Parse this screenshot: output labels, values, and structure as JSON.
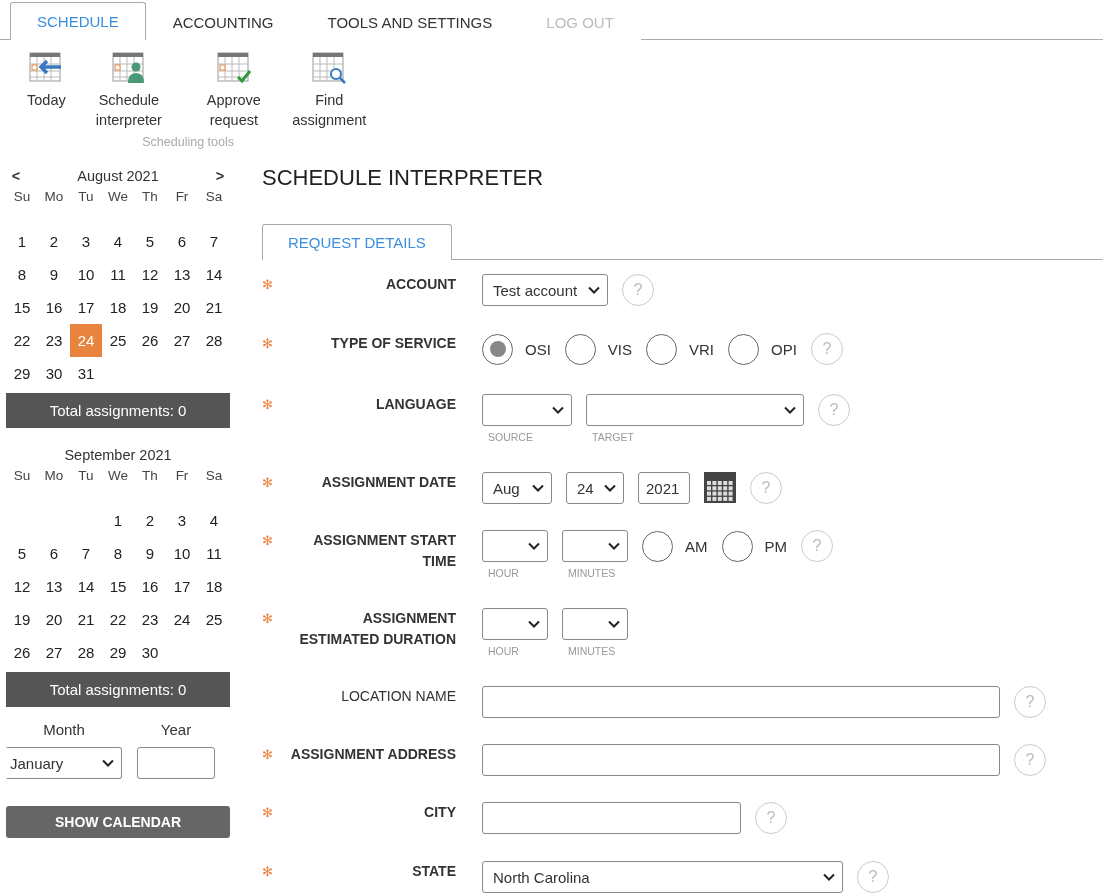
{
  "tabs": [
    {
      "label": "SCHEDULE",
      "selected": true,
      "disabled": false
    },
    {
      "label": "ACCOUNTING",
      "selected": false,
      "disabled": false
    },
    {
      "label": "TOOLS AND SETTINGS",
      "selected": false,
      "disabled": false
    },
    {
      "label": "LOG OUT",
      "selected": false,
      "disabled": true
    }
  ],
  "toolbar": {
    "group_label": "Scheduling tools",
    "items": [
      {
        "kind": "today",
        "label": "Today"
      },
      {
        "kind": "person",
        "label": "Schedule interpreter"
      },
      {
        "kind": "approve",
        "label": "Approve request"
      },
      {
        "kind": "find",
        "label": "Find assignment"
      }
    ]
  },
  "calendars": [
    {
      "prev": "<",
      "title": "August 2021",
      "next": ">",
      "weekdays": [
        "Su",
        "Mo",
        "Tu",
        "We",
        "Th",
        "Fr",
        "Sa"
      ],
      "weeks": [
        [
          {
            "label": "1",
            "selected": false
          },
          {
            "label": "2",
            "selected": false
          },
          {
            "label": "3",
            "selected": false
          },
          {
            "label": "4",
            "selected": false
          },
          {
            "label": "5",
            "selected": false
          },
          {
            "label": "6",
            "selected": false
          },
          {
            "label": "7",
            "selected": false
          }
        ],
        [
          {
            "label": "8",
            "selected": false
          },
          {
            "label": "9",
            "selected": false
          },
          {
            "label": "10",
            "selected": false
          },
          {
            "label": "11",
            "selected": false
          },
          {
            "label": "12",
            "selected": false
          },
          {
            "label": "13",
            "selected": false
          },
          {
            "label": "14",
            "selected": false
          }
        ],
        [
          {
            "label": "15",
            "selected": false
          },
          {
            "label": "16",
            "selected": false
          },
          {
            "label": "17",
            "selected": false
          },
          {
            "label": "18",
            "selected": false
          },
          {
            "label": "19",
            "selected": false
          },
          {
            "label": "20",
            "selected": false
          },
          {
            "label": "21",
            "selected": false
          }
        ],
        [
          {
            "label": "22",
            "selected": false
          },
          {
            "label": "23",
            "selected": false
          },
          {
            "label": "24",
            "selected": true
          },
          {
            "label": "25",
            "selected": false
          },
          {
            "label": "26",
            "selected": false
          },
          {
            "label": "27",
            "selected": false
          },
          {
            "label": "28",
            "selected": false
          }
        ],
        [
          {
            "label": "29",
            "selected": false
          },
          {
            "label": "30",
            "selected": false
          },
          {
            "label": "31",
            "selected": false
          }
        ]
      ],
      "total": "Total assignments: 0"
    },
    {
      "title": "September 2021",
      "weekdays": [
        "Su",
        "Mo",
        "Tu",
        "We",
        "Th",
        "Fr",
        "Sa"
      ],
      "weeks": [
        [
          {
            "label": "1",
            "selected": false
          },
          {
            "label": "2",
            "selected": false
          },
          {
            "label": "3",
            "selected": false
          },
          {
            "label": "4",
            "selected": false
          }
        ],
        [
          {
            "label": "5",
            "selected": false
          },
          {
            "label": "6",
            "selected": false
          },
          {
            "label": "7",
            "selected": false
          },
          {
            "label": "8",
            "selected": false
          },
          {
            "label": "9",
            "selected": false
          },
          {
            "label": "10",
            "selected": false
          },
          {
            "label": "11",
            "selected": false
          }
        ],
        [
          {
            "label": "12",
            "selected": false
          },
          {
            "label": "13",
            "selected": false
          },
          {
            "label": "14",
            "selected": false
          },
          {
            "label": "15",
            "selected": false
          },
          {
            "label": "16",
            "selected": false
          },
          {
            "label": "17",
            "selected": false
          },
          {
            "label": "18",
            "selected": false
          }
        ],
        [
          {
            "label": "19",
            "selected": false
          },
          {
            "label": "20",
            "selected": false
          },
          {
            "label": "21",
            "selected": false
          },
          {
            "label": "22",
            "selected": false
          },
          {
            "label": "23",
            "selected": false
          },
          {
            "label": "24",
            "selected": false
          },
          {
            "label": "25",
            "selected": false
          }
        ],
        [
          {
            "label": "26",
            "selected": false
          },
          {
            "label": "27",
            "selected": false
          },
          {
            "label": "28",
            "selected": false
          },
          {
            "label": "29",
            "selected": false
          },
          {
            "label": "30",
            "selected": false
          }
        ]
      ],
      "total": "Total assignments: 0"
    }
  ],
  "jump": {
    "month_label": "Month",
    "year_label": "Year",
    "month_value": "January",
    "button": "SHOW CALENDAR"
  },
  "page_title": "SCHEDULE INTERPRETER",
  "form_tabs": [
    {
      "label": "REQUEST DETAILS",
      "selected": true
    }
  ],
  "fields": [
    {
      "label": "ACCOUNT",
      "required_mark": "✻",
      "help": "?",
      "controls": [
        {
          "kind": "select",
          "value": "Test account"
        }
      ]
    },
    {
      "label": "TYPE OF SERVICE",
      "required_mark": "✻",
      "help": "?",
      "controls": [
        {
          "kind": "radio",
          "label": "OSI",
          "selected": true
        },
        {
          "kind": "radio",
          "label": "VIS",
          "selected": false
        },
        {
          "kind": "radio",
          "label": "VRI",
          "selected": false
        },
        {
          "kind": "radio",
          "label": "OPI",
          "selected": false
        }
      ]
    },
    {
      "label": "LANGUAGE",
      "required_mark": "✻",
      "help": "?",
      "controls": [
        {
          "kind": "select",
          "caption": "SOURCE"
        },
        {
          "kind": "select",
          "caption": "TARGET"
        }
      ]
    },
    {
      "label": "ASSIGNMENT DATE",
      "required_mark": "✻",
      "help": "?",
      "controls": [
        {
          "kind": "select",
          "value": "Aug"
        },
        {
          "kind": "select",
          "value": "24"
        },
        {
          "kind": "text",
          "value": "2021"
        },
        {
          "kind": "calendar"
        }
      ]
    },
    {
      "label": "ASSIGNMENT START TIME",
      "required_mark": "✻",
      "help": "?",
      "controls": [
        {
          "kind": "select",
          "caption": "HOUR"
        },
        {
          "kind": "select",
          "caption": "MINUTES"
        },
        {
          "kind": "radio",
          "label": "AM",
          "selected": false
        },
        {
          "kind": "radio",
          "label": "PM",
          "selected": false
        }
      ]
    },
    {
      "label": "ASSIGNMENT ESTIMATED DURATION",
      "required_mark": "✻",
      "controls": [
        {
          "kind": "select",
          "caption": "HOUR"
        },
        {
          "kind": "select",
          "caption": "MINUTES"
        }
      ]
    },
    {
      "label": "LOCATION NAME",
      "help": "?",
      "controls": [
        {
          "kind": "text"
        }
      ]
    },
    {
      "label": "ASSIGNMENT ADDRESS",
      "required_mark": "✻",
      "help": "?",
      "controls": [
        {
          "kind": "text"
        }
      ]
    },
    {
      "label": "CITY",
      "required_mark": "✻",
      "help": "?",
      "controls": [
        {
          "kind": "text"
        }
      ]
    },
    {
      "label": "STATE",
      "required_mark": "✻",
      "help": "?",
      "controls": [
        {
          "kind": "select",
          "value": "North Carolina"
        }
      ]
    }
  ]
}
